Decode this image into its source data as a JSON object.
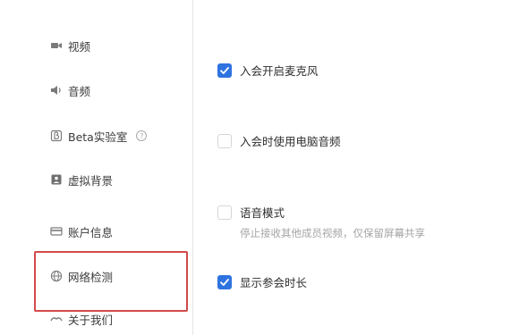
{
  "sidebar": {
    "items": [
      {
        "label": "视频",
        "icon": "video-camera-icon"
      },
      {
        "label": "音频",
        "icon": "speaker-icon"
      },
      {
        "label": "Beta实验室",
        "icon": "beta-icon",
        "help_icon": "help-circle-icon",
        "help_glyph": "?"
      },
      {
        "label": "虚拟背景",
        "icon": "virtual-background-icon"
      },
      {
        "label": "账户信息",
        "icon": "account-card-icon"
      },
      {
        "label": "网络检测",
        "icon": "globe-icon"
      },
      {
        "label": "关于我们",
        "icon": "about-icon"
      }
    ],
    "highlight_color": "#d24b4b"
  },
  "settings": {
    "options": [
      {
        "label": "入会开启麦克风",
        "checked": true
      },
      {
        "label": "入会时使用电脑音频",
        "checked": false
      },
      {
        "label": "语音模式",
        "checked": false,
        "description": "停止接收其他成员视频，仅保留屏幕共享"
      },
      {
        "label": "显示参会时长",
        "checked": true
      }
    ]
  },
  "colors": {
    "accent": "#2f73e0",
    "muted_text": "#a4a4a4"
  }
}
